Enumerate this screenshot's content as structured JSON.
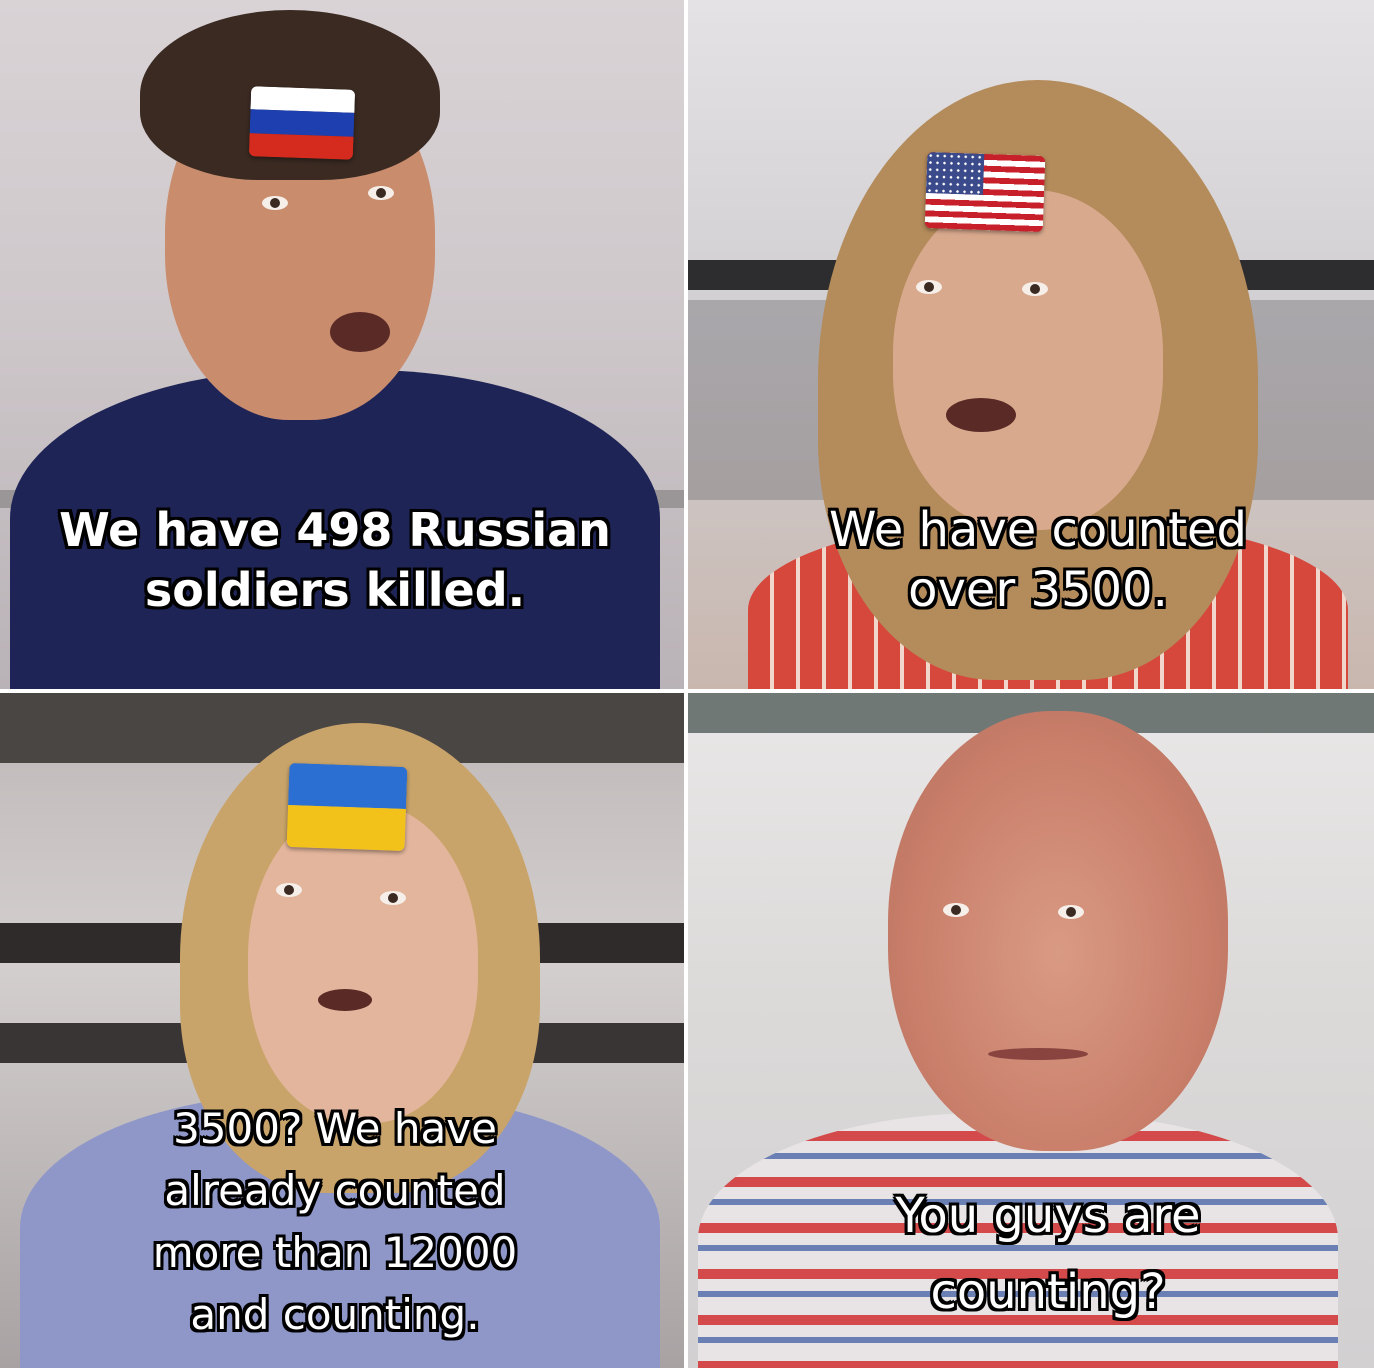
{
  "panels": [
    {
      "caption": "We have 498 Russian\nsoldiers killed.",
      "flag": "russia-flag",
      "colors": {
        "white": "#ffffff",
        "blue": "#1d3fb0",
        "red": "#d52b1e"
      }
    },
    {
      "caption": "We have counted\nover 3500.",
      "flag": "usa-flag",
      "colors": {
        "red": "#c8202a",
        "white": "#ffffff",
        "blue": "#3b4a8a"
      }
    },
    {
      "caption": "3500? We have\nalready counted\nmore than 12000\nand counting.",
      "flag": "ukraine-flag",
      "colors": {
        "blue": "#2a6fd1",
        "yellow": "#f2c21b"
      }
    },
    {
      "caption": "You guys are\ncounting?",
      "flag": ""
    }
  ]
}
